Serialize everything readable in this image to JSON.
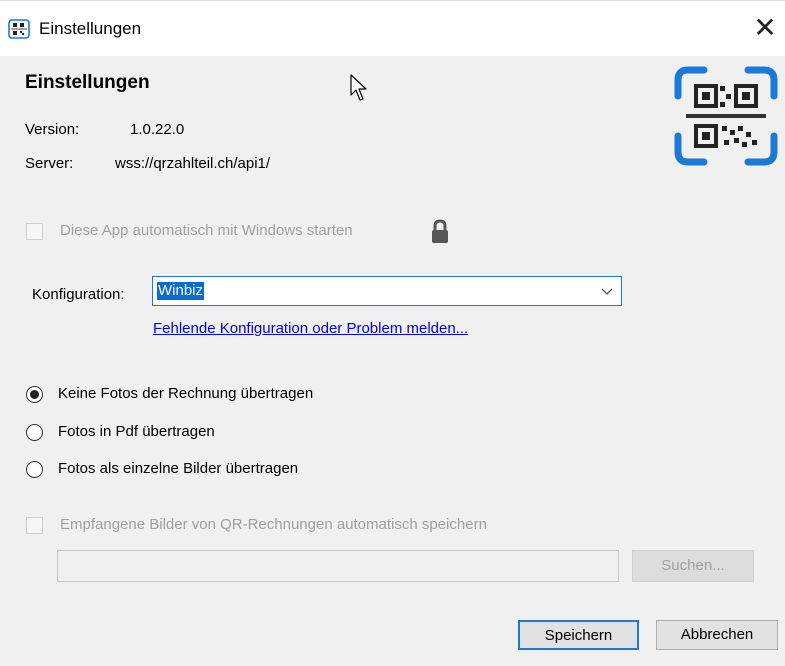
{
  "window": {
    "title": "Einstellungen",
    "close_glyph": "✕",
    "icon": "qr-app-icon"
  },
  "header": {
    "heading": "Einstellungen",
    "version_label": "Version:",
    "version_value": "1.0.22.0",
    "server_label": "Server:",
    "server_value": "wss://qrzahlteil.ch/api1/",
    "logo": "qr-scan-logo"
  },
  "autostart": {
    "label": "Diese App automatisch mit Windows starten",
    "checked": false,
    "enabled": false,
    "lock_icon": "lock-icon"
  },
  "configuration": {
    "label": "Konfiguration:",
    "selected": "Winbiz",
    "link": "Fehlende Konfiguration oder Problem melden..."
  },
  "photos": {
    "options": [
      {
        "label": "Keine Fotos der Rechnung übertragen",
        "selected": true
      },
      {
        "label": "Fotos in Pdf übertragen",
        "selected": false
      },
      {
        "label": "Fotos als einzelne Bilder übertragen",
        "selected": false
      }
    ]
  },
  "save_images": {
    "label": "Empfangene Bilder von QR-Rechnungen automatisch speichern",
    "checked": false,
    "enabled": false,
    "path_value": "",
    "search_label": "Suchen..."
  },
  "buttons": {
    "save": "Speichern",
    "cancel": "Abbrechen"
  },
  "colors": {
    "accent": "#1d79d6",
    "selection": "#0a6bd0",
    "link": "#0000ee",
    "disabled_text": "#a0a0a0",
    "background": "#f0f0f0"
  }
}
